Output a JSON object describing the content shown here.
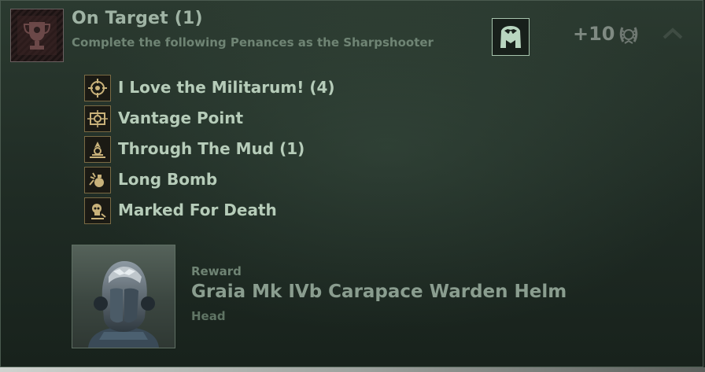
{
  "achievement": {
    "title": "On Target (1)",
    "description": "Complete the following Penances as the Sharpshooter",
    "points": "+10",
    "icon": "trophy-icon",
    "class_icon": "eagle-emblem-icon",
    "points_icon": "laurel-icon",
    "collapse_icon": "chevron-up-icon"
  },
  "penances": [
    {
      "label": "I Love the Militarum! (4)",
      "icon": "crosshair-icon"
    },
    {
      "label": "Vantage Point",
      "icon": "scope-icon"
    },
    {
      "label": "Through The Mud (1)",
      "icon": "mud-icon"
    },
    {
      "label": "Long Bomb",
      "icon": "grenade-icon"
    },
    {
      "label": "Marked For Death",
      "icon": "skull-mark-icon"
    }
  ],
  "reward": {
    "label": "Reward",
    "name": "Graia Mk IVb Carapace Warden Helm",
    "slot": "Head"
  },
  "colors": {
    "title": "#9fb3a4",
    "penance_text": "#b6ccb9",
    "emblem_border": "#a7c4ad",
    "icon_gold": "#c9b27a"
  }
}
